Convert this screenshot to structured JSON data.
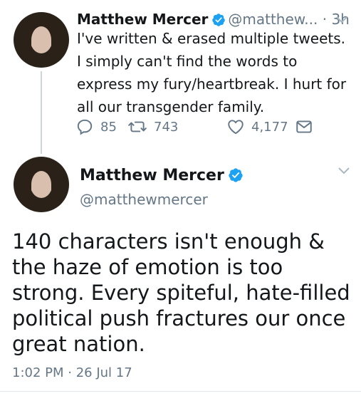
{
  "tweet1": {
    "name": "Matthew Mercer",
    "handle": "@matthew...",
    "time": "· 3h",
    "text": "I've written & erased multiple tweets. I simply can't find the words to express my fury/heartbreak. I hurt for all our transgender family.",
    "replies": "85",
    "retweets": "743",
    "likes": "4,177"
  },
  "tweet2": {
    "name": "Matthew Mercer",
    "handle": "@matthewmercer",
    "text": "140 characters isn't enough & the haze of emotion is too strong. Every spiteful, hate-filled political push fractures our once great nation.",
    "timestamp": "1:02 PM · 26 Jul 17"
  },
  "icons": {
    "verified": "verified-badge-icon",
    "reply": "reply-icon",
    "retweet": "retweet-icon",
    "like": "heart-icon",
    "dm": "envelope-icon",
    "menu": "chevron-down-icon"
  },
  "colors": {
    "verified": "#1da1f2",
    "secondary_text": "#657786",
    "thread_line": "#ccd6dd"
  }
}
